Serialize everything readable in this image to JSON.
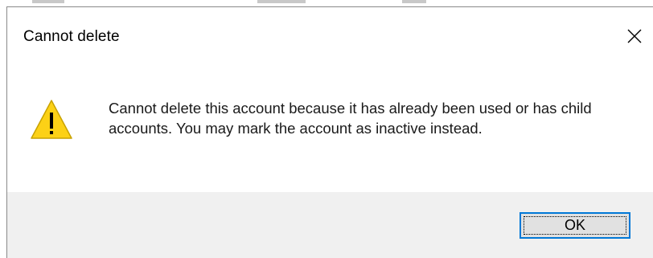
{
  "dialog": {
    "title": "Cannot delete",
    "message": "Cannot delete this account because it has already been used or has child accounts. You may mark the account as inactive instead.",
    "icon": "warning-icon",
    "ok_label": "OK",
    "close_icon": "close-icon"
  },
  "colors": {
    "accent": "#0078d7",
    "footer_bg": "#f0f0f0",
    "warning_fill": "#fcd116"
  }
}
